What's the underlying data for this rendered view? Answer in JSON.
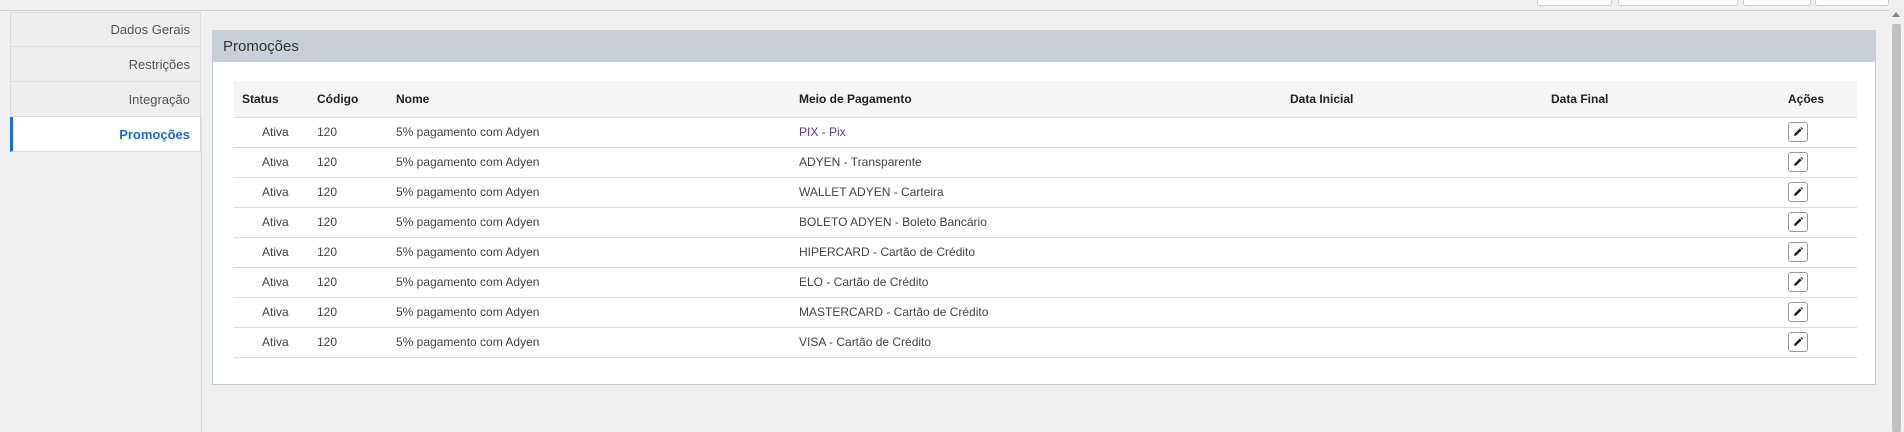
{
  "sidebar": {
    "items": [
      {
        "label": "Dados Gerais"
      },
      {
        "label": "Restrições"
      },
      {
        "label": "Integração"
      },
      {
        "label": "Promoções",
        "active": true
      }
    ]
  },
  "panel": {
    "title": "Promoções"
  },
  "table": {
    "headers": {
      "status": "Status",
      "codigo": "Código",
      "nome": "Nome",
      "meio": "Meio de Pagamento",
      "data_inicial": "Data Inicial",
      "data_final": "Data Final",
      "acoes": "Ações"
    },
    "rows": [
      {
        "status": "Ativa",
        "codigo": "120",
        "nome": "5% pagamento com Adyen",
        "meio": "PIX - Pix",
        "data_inicial": "",
        "data_final": ""
      },
      {
        "status": "Ativa",
        "codigo": "120",
        "nome": "5% pagamento com Adyen",
        "meio": "ADYEN - Transparente",
        "data_inicial": "",
        "data_final": ""
      },
      {
        "status": "Ativa",
        "codigo": "120",
        "nome": "5% pagamento com Adyen",
        "meio": "WALLET ADYEN - Carteira",
        "data_inicial": "",
        "data_final": ""
      },
      {
        "status": "Ativa",
        "codigo": "120",
        "nome": "5% pagamento com Adyen",
        "meio": "BOLETO ADYEN - Boleto Bancário",
        "data_inicial": "",
        "data_final": ""
      },
      {
        "status": "Ativa",
        "codigo": "120",
        "nome": "5% pagamento com Adyen",
        "meio": "HIPERCARD - Cartão de Crédito",
        "data_inicial": "",
        "data_final": ""
      },
      {
        "status": "Ativa",
        "codigo": "120",
        "nome": "5% pagamento com Adyen",
        "meio": "ELO - Cartão de Crédito",
        "data_inicial": "",
        "data_final": ""
      },
      {
        "status": "Ativa",
        "codigo": "120",
        "nome": "5% pagamento com Adyen",
        "meio": "MASTERCARD - Cartão de Crédito",
        "data_inicial": "",
        "data_final": ""
      },
      {
        "status": "Ativa",
        "codigo": "120",
        "nome": "5% pagamento com Adyen",
        "meio": "VISA - Cartão de Crédito",
        "data_inicial": "",
        "data_final": ""
      }
    ]
  },
  "icons": {
    "edit": "pencil-icon"
  },
  "colors": {
    "accent": "#1a6fd6",
    "panel_header": "#c9cfd6",
    "pix_link": "#5b3a8c"
  }
}
